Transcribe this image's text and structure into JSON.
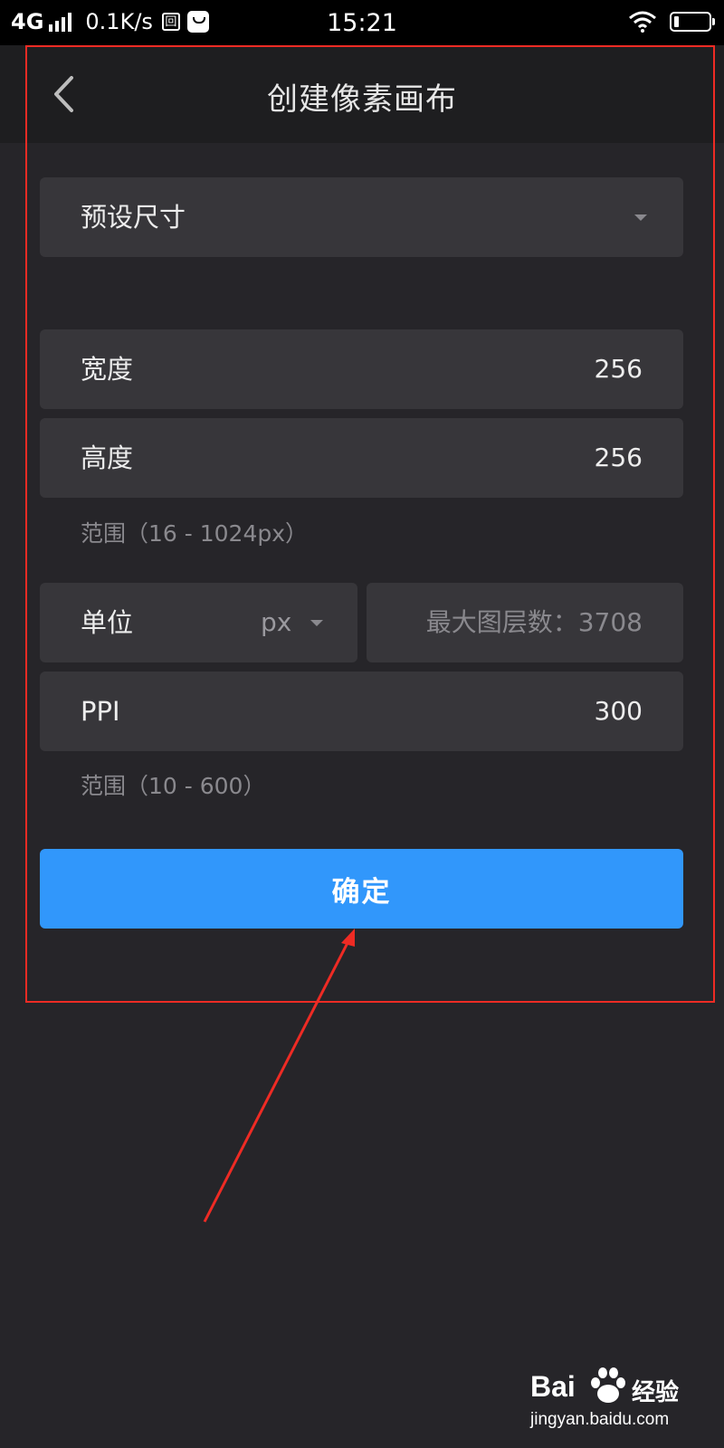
{
  "status_bar": {
    "network": "4G",
    "speed": "0.1K/s",
    "box_icon_text": "回",
    "time": "15:21"
  },
  "header": {
    "title": "创建像素画布"
  },
  "form": {
    "preset": {
      "label": "预设尺寸"
    },
    "width": {
      "label": "宽度",
      "value": "256"
    },
    "height": {
      "label": "高度",
      "value": "256"
    },
    "size_range_hint": "范围（16 - 1024px）",
    "unit": {
      "label": "单位",
      "value": "px"
    },
    "max_layers": "最大图层数：3708",
    "ppi": {
      "label": "PPI",
      "value": "300"
    },
    "ppi_range_hint": "范围（10 - 600）",
    "confirm_label": "确定"
  },
  "colors": {
    "background": "#262529",
    "row_background": "#37363a",
    "accent_button": "#3197fb",
    "annotation_red": "#ee2b24"
  },
  "watermark": {
    "brand": "Bai",
    "brand_suffix": "经验",
    "url": "jingyan.baidu.com"
  }
}
